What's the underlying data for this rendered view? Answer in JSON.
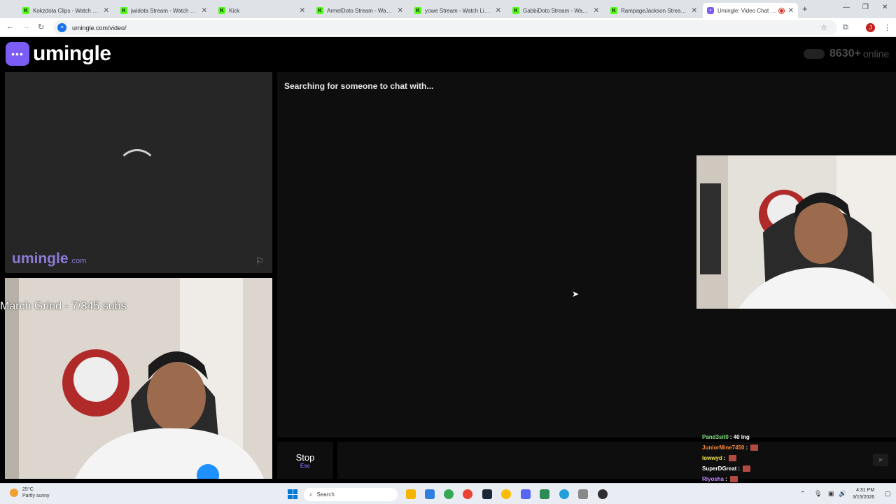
{
  "browser": {
    "tabs": [
      {
        "label": "Kokzdota Clips - Watch Live",
        "icon": "kick-favicon",
        "active": false
      },
      {
        "label": "jwidota Stream - Watch Live",
        "icon": "kick-favicon",
        "active": false
      },
      {
        "label": "Kick",
        "icon": "kick-favicon",
        "active": false
      },
      {
        "label": "ArmelDoto Stream - Watch Li",
        "icon": "kick-favicon",
        "active": false
      },
      {
        "label": "yowe Stream - Watch Live on",
        "icon": "kick-favicon",
        "active": false
      },
      {
        "label": "GabbiDoto Stream - Watch Li",
        "icon": "kick-favicon",
        "active": false
      },
      {
        "label": "RampageJackson Stream - W",
        "icon": "kick-favicon",
        "active": false
      },
      {
        "label": "Umingle: Video Chat with",
        "icon": "umingle-favicon",
        "active": true
      }
    ],
    "url": "umingle.com/video/",
    "profile_initial": "J"
  },
  "site": {
    "logo_text": "umingle",
    "online_count": "8630+",
    "online_label": "online"
  },
  "remote_video": {
    "watermark_main": "umingle",
    "watermark_domain": ".com"
  },
  "local_video": {
    "overlay_text": "March Grind - 7/345 subs"
  },
  "chat": {
    "status_text": "Searching for someone to chat with...",
    "stop_label": "Stop",
    "stop_key": "Esc"
  },
  "stream_chat": [
    {
      "user": "Pand3sit0",
      "message": "40 lng",
      "user_color": "#7fe07f",
      "emote": false
    },
    {
      "user": "JuniorMine7450",
      "message": "",
      "user_color": "#ff8a3d",
      "emote": true
    },
    {
      "user": "lowwyd",
      "message": "",
      "user_color": "#f2e44a",
      "emote": true
    },
    {
      "user": "SuperDGreat",
      "message": "",
      "user_color": "#ffffff",
      "emote": true
    },
    {
      "user": "Riyosha",
      "message": "",
      "user_color": "#c58cff",
      "emote": true
    }
  ],
  "taskbar": {
    "weather_temp": "25°C",
    "weather_desc": "Partly sunny",
    "search_placeholder": "Search",
    "time": "4:31 PM",
    "date": "3/15/2026"
  },
  "colors": {
    "brand": "#7b5cf5",
    "kick": "#53fc18"
  }
}
